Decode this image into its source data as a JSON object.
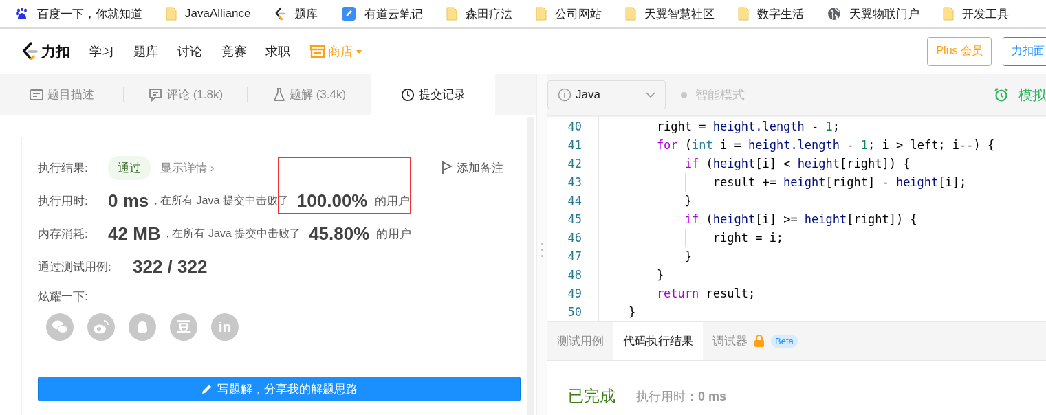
{
  "bookmarks": [
    {
      "kind": "baidu",
      "label": "百度一下，你就知道"
    },
    {
      "kind": "folder",
      "label": "JavaAlliance"
    },
    {
      "kind": "leetcode",
      "label": "题库"
    },
    {
      "kind": "youdao",
      "label": "有道云笔记"
    },
    {
      "kind": "folder",
      "label": "森田疗法"
    },
    {
      "kind": "folder",
      "label": "公司网站"
    },
    {
      "kind": "folder",
      "label": "天翼智慧社区"
    },
    {
      "kind": "folder",
      "label": "数字生活"
    },
    {
      "kind": "globe",
      "label": "天翼物联门户"
    },
    {
      "kind": "folder",
      "label": "开发工具"
    }
  ],
  "nav": {
    "brand": "力扣",
    "items": [
      {
        "label": "学习",
        "kind": "plain"
      },
      {
        "label": "题库",
        "kind": "plain"
      },
      {
        "label": "讨论",
        "kind": "plain"
      },
      {
        "label": "竞赛",
        "kind": "plain"
      },
      {
        "label": "求职",
        "kind": "plain"
      },
      {
        "label": "商店",
        "kind": "store"
      }
    ],
    "buttons": [
      {
        "label": "Plus 会员",
        "kind": "plus"
      },
      {
        "label": "力扣面",
        "kind": "primary"
      }
    ]
  },
  "problem_tabs": [
    {
      "kind": "description",
      "label": "题目描述",
      "selected": false
    },
    {
      "kind": "comments",
      "label": "评论 (1.8k)",
      "selected": false
    },
    {
      "kind": "solutions",
      "label": "题解 (3.4k)",
      "selected": false
    },
    {
      "kind": "submissions",
      "label": "提交记录",
      "selected": true
    }
  ],
  "result": {
    "label": "执行结果:",
    "status": "通过",
    "details_link": "显示详情 ›",
    "note_button": "添加备注",
    "stats": [
      {
        "label": "执行用时:",
        "value": "0 ms",
        "middle": ", 在所有 Java 提交中击败了",
        "percent": "100.00%",
        "suffix": "的用户"
      },
      {
        "label": "内存消耗:",
        "value": "42 MB",
        "middle": ", 在所有 Java 提交中击败了",
        "percent": "45.80%",
        "suffix": "的用户"
      }
    ],
    "tests": {
      "label": "通过测试用例:",
      "value": "322 / 322"
    },
    "share_label": "炫耀一下:",
    "share": [
      {
        "kind": "wechat"
      },
      {
        "kind": "weibo"
      },
      {
        "kind": "qq"
      },
      {
        "kind": "text",
        "text": "豆"
      },
      {
        "kind": "text",
        "text": "in"
      }
    ],
    "write_button": "写题解，分享我的解题思路"
  },
  "editor_toolbar": {
    "language": "Java",
    "smart_mode": {
      "label": "智能模式",
      "on": false
    },
    "mock": "模拟"
  },
  "code": [
    {
      "number": "40",
      "tokens": [
        {
          "kind": "plain",
          "text": "        right = "
        },
        {
          "kind": "var",
          "text": "height.length"
        },
        {
          "kind": "plain",
          "text": " - "
        },
        {
          "kind": "num",
          "text": "1"
        },
        {
          "kind": "plain",
          "text": ";"
        }
      ]
    },
    {
      "number": "41",
      "tokens": [
        {
          "kind": "kw",
          "text": "        for"
        },
        {
          "kind": "plain",
          "text": " ("
        },
        {
          "kind": "type",
          "text": "int"
        },
        {
          "kind": "plain",
          "text": " i = "
        },
        {
          "kind": "var",
          "text": "height.length"
        },
        {
          "kind": "plain",
          "text": " - "
        },
        {
          "kind": "num",
          "text": "1"
        },
        {
          "kind": "plain",
          "text": "; i > left; i--) {"
        }
      ]
    },
    {
      "number": "42",
      "tokens": [
        {
          "kind": "kw",
          "text": "            if"
        },
        {
          "kind": "plain",
          "text": " ("
        },
        {
          "kind": "var",
          "text": "height"
        },
        {
          "kind": "plain",
          "text": "[i] < "
        },
        {
          "kind": "var",
          "text": "height"
        },
        {
          "kind": "plain",
          "text": "[right]) {"
        }
      ]
    },
    {
      "number": "43",
      "tokens": [
        {
          "kind": "plain",
          "text": "                result += "
        },
        {
          "kind": "var",
          "text": "height"
        },
        {
          "kind": "plain",
          "text": "[right] - "
        },
        {
          "kind": "var",
          "text": "height"
        },
        {
          "kind": "plain",
          "text": "[i];"
        }
      ]
    },
    {
      "number": "44",
      "tokens": [
        {
          "kind": "plain",
          "text": "            }"
        }
      ]
    },
    {
      "number": "45",
      "tokens": [
        {
          "kind": "kw",
          "text": "            if"
        },
        {
          "kind": "plain",
          "text": " ("
        },
        {
          "kind": "var",
          "text": "height"
        },
        {
          "kind": "plain",
          "text": "[i] >= "
        },
        {
          "kind": "var",
          "text": "height"
        },
        {
          "kind": "plain",
          "text": "[right]) {"
        }
      ]
    },
    {
      "number": "46",
      "tokens": [
        {
          "kind": "plain",
          "text": "                right = i;"
        }
      ]
    },
    {
      "number": "47",
      "tokens": [
        {
          "kind": "plain",
          "text": "            }"
        }
      ]
    },
    {
      "number": "48",
      "tokens": [
        {
          "kind": "plain",
          "text": "        }"
        }
      ]
    },
    {
      "number": "49",
      "tokens": [
        {
          "kind": "kw",
          "text": "        return"
        },
        {
          "kind": "plain",
          "text": " result;"
        }
      ]
    },
    {
      "number": "50",
      "tokens": [
        {
          "kind": "plain",
          "text": "    }"
        }
      ]
    }
  ],
  "console_tabs": [
    {
      "label": "测试用例",
      "selected": false
    },
    {
      "label": "代码执行结果",
      "selected": true
    },
    {
      "label": "调试器",
      "selected": false,
      "locked": true,
      "badge": "Beta"
    }
  ],
  "console_result": {
    "status": "已完成",
    "runtime": "执行用时：**0 ms**"
  }
}
